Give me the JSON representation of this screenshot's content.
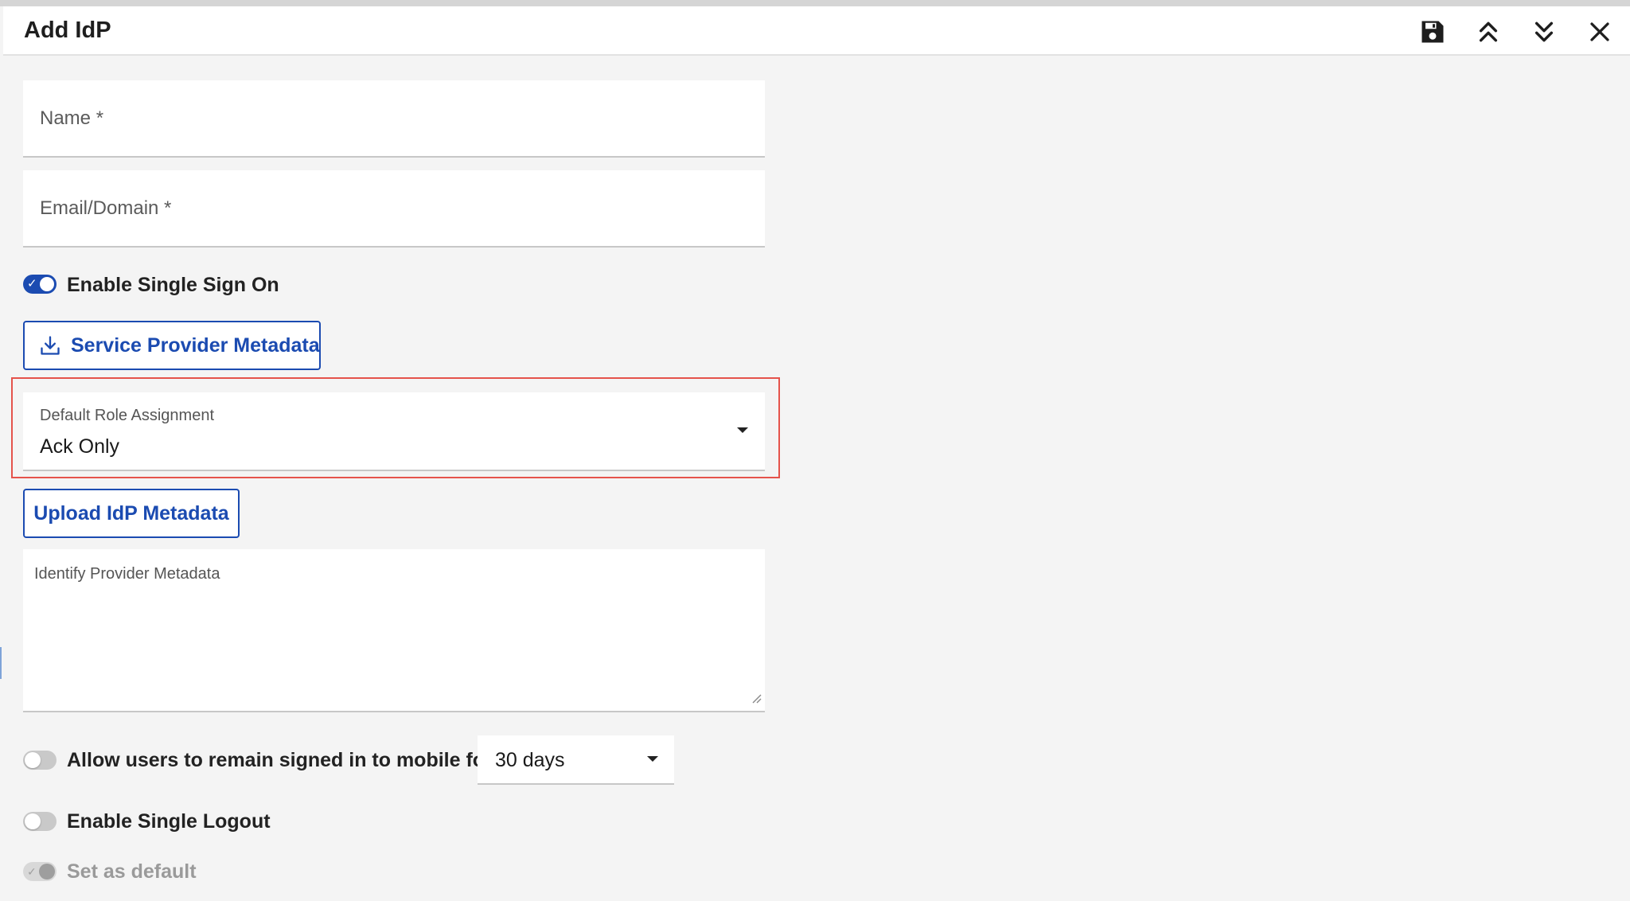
{
  "dialog": {
    "title": "Add IdP",
    "header_icons": [
      "save-icon",
      "chevron-double-up-icon",
      "chevron-double-down-icon",
      "close-icon"
    ]
  },
  "form": {
    "name_placeholder": "Name *",
    "email_placeholder": "Email/Domain *",
    "sso_toggle_label": "Enable Single Sign On",
    "sso_enabled": true,
    "sp_metadata_button": "Service Provider Metadata",
    "default_role": {
      "label": "Default Role Assignment",
      "value": "Ack Only"
    },
    "upload_button": "Upload IdP Metadata",
    "metadata_textarea_label": "Identify Provider Metadata",
    "mobile_toggle_label": "Allow users to remain signed in to mobile for",
    "mobile_enabled": false,
    "mobile_duration": "30 days",
    "single_logout_label": "Enable Single Logout",
    "single_logout_enabled": false,
    "set_default_label": "Set as default",
    "set_default_enabled": true
  },
  "colors": {
    "accent": "#1b4bb1",
    "highlight": "#e5534b",
    "background": "#f4f4f4"
  }
}
